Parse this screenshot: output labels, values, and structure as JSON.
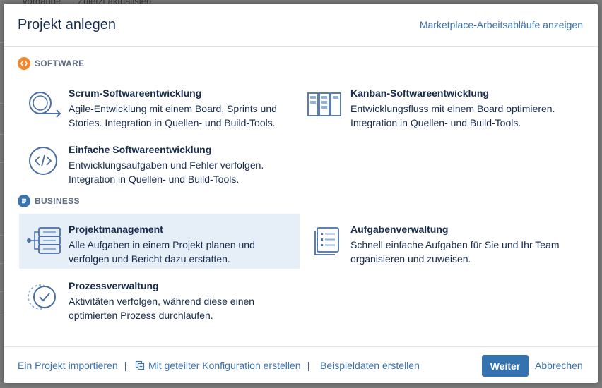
{
  "background": {
    "header_cols": [
      "vorgänge",
      "Zuletzt aktualisiert"
    ]
  },
  "dialog": {
    "title": "Projekt anlegen",
    "marketplace_link": "Marketplace-Arbeitsabläufe anzeigen"
  },
  "sections": {
    "software": {
      "label": "SOFTWARE",
      "icon": "code-icon",
      "color": "#f0882f"
    },
    "business": {
      "label": "BUSINESS",
      "icon": "document-icon",
      "color": "#3b73af"
    }
  },
  "templates": {
    "scrum": {
      "name": "Scrum-Softwareentwicklung",
      "desc": "Agile-Entwicklung mit einem Board, Sprints und Stories. Integration in Quellen- und Build-Tools.",
      "icon": "scrum-cycle-icon"
    },
    "kanban": {
      "name": "Kanban-Softwareentwicklung",
      "desc": "Entwicklungsfluss mit einem Board optimieren. Integration in Quellen- und Build-Tools.",
      "icon": "kanban-board-icon"
    },
    "simple": {
      "name": "Einfache Softwareentwicklung",
      "desc": "Entwicklungsaufgaben und Fehler verfolgen. Integration in Quellen- und Build-Tools.",
      "icon": "code-circle-icon"
    },
    "projectmgmt": {
      "name": "Projektmanagement",
      "desc": "Alle Aufgaben in einem Projekt planen und verfolgen und Bericht dazu erstatten.",
      "icon": "project-tree-icon",
      "selected": true
    },
    "tasks": {
      "name": "Aufgabenverwaltung",
      "desc": "Schnell einfache Aufgaben für Sie und Ihr Team organisieren und zuweisen.",
      "icon": "task-list-icon"
    },
    "process": {
      "name": "Prozessverwaltung",
      "desc": "Aktivitäten verfolgen, während diese einen optimierten Prozess durchlaufen.",
      "icon": "process-check-icon"
    }
  },
  "footer": {
    "import_link": "Ein Projekt importieren",
    "separator": "|",
    "shared_config_link": "Mit geteilter Konfiguration erstellen",
    "sample_data_link": "Beispieldaten erstellen",
    "next_button": "Weiter",
    "cancel_link": "Abbrechen"
  },
  "colors": {
    "link": "#3b73af",
    "primary_button": "#3572b0",
    "selected_row": "#e6eef7"
  }
}
